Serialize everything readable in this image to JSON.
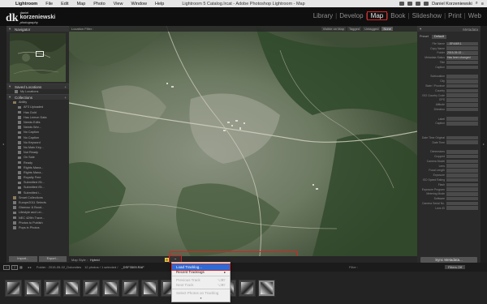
{
  "menubar": {
    "apple": "",
    "items": [
      "Lightroom",
      "File",
      "Edit",
      "Map",
      "Photo",
      "View",
      "Window",
      "Help"
    ],
    "window_title": "Lightroom 5 Catalog.lrcat - Adobe Photoshop Lightroom - Map",
    "user": "Daniel Korzeniewski"
  },
  "identity": {
    "mark": "dk",
    "line1": "daniel",
    "line2": "korzeniewski",
    "line3": "photography"
  },
  "modules": [
    "Library",
    "Develop",
    "Map",
    "Book",
    "Slideshow",
    "Print",
    "Web"
  ],
  "active_module": "Map",
  "left_panel": {
    "navigator_title": "Navigator",
    "saved_locations_title": "Saved Locations",
    "saved_locations_item": "My Locations",
    "collections_title": "Collections",
    "collections": [
      {
        "label": "Ability",
        "count": "",
        "type": "folder",
        "indent": 1
      },
      {
        "label": "AF3 Uploaded",
        "count": "",
        "indent": 2
      },
      {
        "label": "Has Gold",
        "count": "",
        "indent": 2
      },
      {
        "label": "Has Lemon Data",
        "count": "",
        "indent": 2
      },
      {
        "label": "Needs Edits",
        "count": "",
        "indent": 2
      },
      {
        "label": "Needs Wor...",
        "count": "",
        "indent": 2
      },
      {
        "label": "No Caption",
        "count": "",
        "indent": 2
      },
      {
        "label": "No Caption",
        "count": "",
        "indent": 2
      },
      {
        "label": "No Keyword",
        "count": "",
        "indent": 2
      },
      {
        "label": "No Main Key...",
        "count": "",
        "indent": 2
      },
      {
        "label": "Not Ready",
        "count": "",
        "indent": 2
      },
      {
        "label": "On Sale",
        "count": "",
        "indent": 2
      },
      {
        "label": "Ready",
        "count": "",
        "indent": 2
      },
      {
        "label": "Rights Mana...",
        "count": "",
        "indent": 2
      },
      {
        "label": "Rights Mana...",
        "count": "",
        "indent": 2
      },
      {
        "label": "Royalty Free",
        "count": "",
        "indent": 2
      },
      {
        "label": "Submitted iSt...",
        "count": "",
        "indent": 2
      },
      {
        "label": "Submitted iSt...",
        "count": "",
        "indent": 2
      },
      {
        "label": "Submitted i...",
        "count": "",
        "indent": 2
      },
      {
        "label": "Smart Collections",
        "count": "",
        "type": "folder",
        "indent": 1
      },
      {
        "label": "Europe2011 Selects",
        "count": "",
        "indent": 1
      },
      {
        "label": "Glamour & Boud...",
        "count": "",
        "indent": 1
      },
      {
        "label": "Lifestyle and Lei...",
        "count": "",
        "indent": 1
      },
      {
        "label": "NEC 429th Trave...",
        "count": "",
        "indent": 1
      },
      {
        "label": "Photos to Publish",
        "count": "",
        "indent": 1
      },
      {
        "label": "Pops in Photos",
        "count": "",
        "indent": 1
      }
    ],
    "import_label": "Import...",
    "export_label": "Export..."
  },
  "filter_bar": {
    "label": "Location Filter :",
    "filters": [
      {
        "label": "Visible on Map",
        "on": false
      },
      {
        "label": "Tagged",
        "on": false
      },
      {
        "label": "Untagged",
        "on": false
      },
      {
        "label": "None",
        "on": true
      }
    ]
  },
  "right_panel": {
    "header": "Metadata",
    "preset_label": "Preset",
    "preset_value": "Default",
    "fields": [
      {
        "k": "File Name",
        "v": "...SF4469.1"
      },
      {
        "k": "Copy Name",
        "v": ""
      },
      {
        "k": "Folder",
        "v": "2015-05-02 ..."
      },
      {
        "k": "Metadata Status",
        "v": "Has been changed"
      },
      {
        "k": "Title",
        "v": ""
      },
      {
        "k": "Caption",
        "v": ""
      },
      {
        "k": "",
        "v": ""
      },
      {
        "k": "Sublocation",
        "v": ""
      },
      {
        "k": "City",
        "v": ""
      },
      {
        "k": "State / Province",
        "v": ""
      },
      {
        "k": "Country",
        "v": ""
      },
      {
        "k": "ISO Country Code",
        "v": ""
      },
      {
        "k": "GPS",
        "v": ""
      },
      {
        "k": "Altitude",
        "v": ""
      },
      {
        "k": "Direction",
        "v": ""
      },
      {
        "k": "",
        "v": ""
      },
      {
        "k": "Label",
        "v": ""
      },
      {
        "k": "Caption",
        "v": ""
      },
      {
        "k": "",
        "v": ""
      },
      {
        "k": "",
        "v": ""
      },
      {
        "k": "Date Time Original",
        "v": ""
      },
      {
        "k": "Date Time",
        "v": ""
      },
      {
        "k": "",
        "v": ""
      },
      {
        "k": "Dimensions",
        "v": ""
      },
      {
        "k": "Cropped",
        "v": ""
      },
      {
        "k": "Camera Model",
        "v": ""
      },
      {
        "k": "Lens",
        "v": ""
      },
      {
        "k": "Focal Length",
        "v": ""
      },
      {
        "k": "Exposure",
        "v": ""
      },
      {
        "k": "ISO Speed Rating",
        "v": ""
      },
      {
        "k": "Flash",
        "v": ""
      },
      {
        "k": "Exposure Program",
        "v": ""
      },
      {
        "k": "Metering Mode",
        "v": ""
      },
      {
        "k": "Software",
        "v": ""
      },
      {
        "k": "Camera Serial No.",
        "v": ""
      },
      {
        "k": "Lens ID",
        "v": ""
      }
    ],
    "sync_button": "Sync Metadata..."
  },
  "toolbar": {
    "map_style_label": "Map Style :",
    "map_style_value": "Hybrid",
    "track_label": "~"
  },
  "filmstrip_bar": {
    "page1": "1",
    "page2": "2",
    "source": "Folder : 2015-05-02_Dolomites",
    "count": "12 photos / 1 selected /",
    "filename": "_DSF3509.RAF",
    "filter_label": "Filter :",
    "filter_value": "Filters Off"
  },
  "filmstrip_thumb_count": 14,
  "track_menu": {
    "items": [
      {
        "label": "Load Tracklog...",
        "shortcut": "",
        "state": "highlight"
      },
      {
        "label": "Recent Tracklogs",
        "shortcut": "▸",
        "state": "normal"
      },
      {
        "label": "",
        "shortcut": "",
        "state": "sep"
      },
      {
        "label": "Previous Track",
        "shortcut": "⌥⌘T",
        "state": "disabled"
      },
      {
        "label": "Next Track",
        "shortcut": "⌥⌘T",
        "state": "disabled"
      },
      {
        "label": "",
        "shortcut": "",
        "state": "sep"
      },
      {
        "label": "Select Photos on Tracklog",
        "shortcut": "",
        "state": "disabled"
      }
    ],
    "more": "▾"
  },
  "colors": {
    "highlight": "#e02020",
    "menu_select": "#2b6bd8"
  }
}
